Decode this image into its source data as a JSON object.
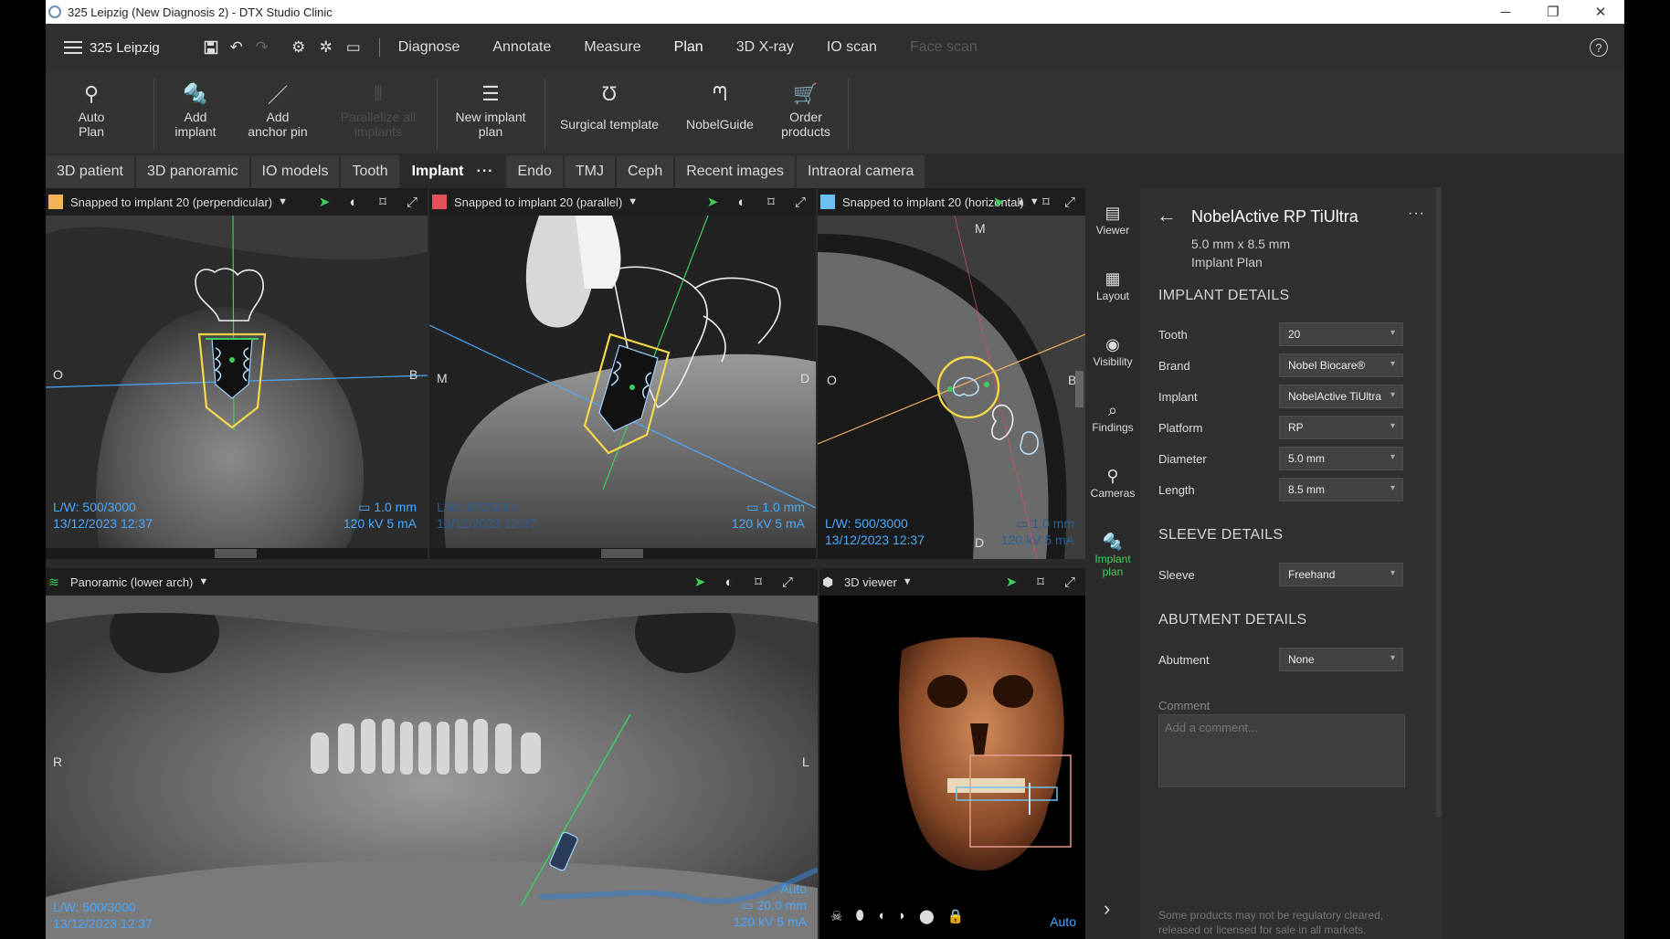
{
  "window": {
    "title": "325 Leipzig (New Diagnosis 2) - DTX Studio Clinic",
    "controls": [
      "─",
      "❐",
      "✕"
    ]
  },
  "navbar": {
    "patient": "325 Leipzig",
    "items": [
      {
        "label": "Diagnose",
        "state": "normal"
      },
      {
        "label": "Annotate",
        "state": "normal"
      },
      {
        "label": "Measure",
        "state": "normal"
      },
      {
        "label": "Plan",
        "state": "active"
      },
      {
        "label": "3D X-ray",
        "state": "normal"
      },
      {
        "label": "IO scan",
        "state": "normal"
      },
      {
        "label": "Face scan",
        "state": "disabled"
      }
    ],
    "help": "?"
  },
  "ribbon": {
    "auto_plan": "Auto\nPlan",
    "add_implant": "Add\nimplant",
    "add_anchor_pin": "Add\nanchor pin",
    "parallelize": "Parallelize all\nimplants",
    "new_implant_plan": "New implant\nplan",
    "surgical_template": "Surgical template",
    "nobelguide": "NobelGuide",
    "order_products": "Order\nproducts"
  },
  "tabs": {
    "items": [
      "3D patient",
      "3D panoramic",
      "IO models",
      "Tooth",
      "Implant",
      "Endo",
      "TMJ",
      "Ceph",
      "Recent images",
      "Intraoral camera"
    ],
    "active": "Implant",
    "more": "···"
  },
  "viewports": {
    "perpendicular": {
      "title": "Snapped to implant 20 (perpendicular)",
      "color": "#f5b25c",
      "lw": "L/W: 500/3000",
      "date": "13/12/2023 12:37",
      "thickness": "1.0 mm",
      "kv": "120 kV  5 mA",
      "left": "O",
      "right": "B"
    },
    "parallel": {
      "title": "Snapped to implant 20 (parallel)",
      "color": "#e2505a",
      "lw": "L/W: 500/3000",
      "date": "13/12/2023 12:37",
      "thickness": "1.0 mm",
      "kv": "120 kV  5 mA",
      "left": "M",
      "right": "D"
    },
    "horizontal": {
      "title": "Snapped to implant 20 (horizontal)",
      "color": "#6cc2ee",
      "lw": "L/W: 500/3000",
      "date": "13/12/2023 12:37",
      "thickness": "1.0 mm",
      "kv": "120 kV  5 mA",
      "top": "M",
      "bottom": "D",
      "left": "O",
      "right": "B"
    },
    "panoramic": {
      "title": "Panoramic (lower arch)",
      "color": "#3ecf5a",
      "lw": "L/W: 500/3000",
      "date": "13/12/2023 12:37",
      "auto": "Auto",
      "thickness": "20.0 mm",
      "kv": "120 kV  5 mA",
      "left": "R",
      "right": "L"
    },
    "viewer3d": {
      "title": "3D viewer",
      "auto": "Auto"
    }
  },
  "right_tools": [
    {
      "label": "Viewer",
      "icon": "viewer-icon"
    },
    {
      "label": "Layout",
      "icon": "layout-icon"
    },
    {
      "label": "Visibility",
      "icon": "eye-icon"
    },
    {
      "label": "Findings",
      "icon": "findings-icon"
    },
    {
      "label": "Cameras",
      "icon": "camera-icon"
    },
    {
      "label": "Implant\nplan",
      "icon": "implant-plan-icon",
      "active": true
    }
  ],
  "panel": {
    "title": "NobelActive RP TiUltra",
    "size": "5.0 mm x 8.5 mm",
    "type": "Implant Plan",
    "implant_details_heading": "IMPLANT DETAILS",
    "fields": [
      {
        "label": "Tooth",
        "value": "20"
      },
      {
        "label": "Brand",
        "value": "Nobel Biocare®"
      },
      {
        "label": "Implant",
        "value": "NobelActive TiUltra"
      },
      {
        "label": "Platform",
        "value": "RP"
      },
      {
        "label": "Diameter",
        "value": "5.0 mm"
      },
      {
        "label": "Length",
        "value": "8.5 mm"
      }
    ],
    "sleeve_heading": "SLEEVE DETAILS",
    "sleeve": {
      "label": "Sleeve",
      "value": "Freehand"
    },
    "abutment_heading": "ABUTMENT DETAILS",
    "abutment": {
      "label": "Abutment",
      "value": "None"
    },
    "comment_label": "Comment",
    "comment_placeholder": "Add a comment...",
    "disclaimer": "Some products may not be regulatory cleared, released or licensed for sale in all markets."
  }
}
